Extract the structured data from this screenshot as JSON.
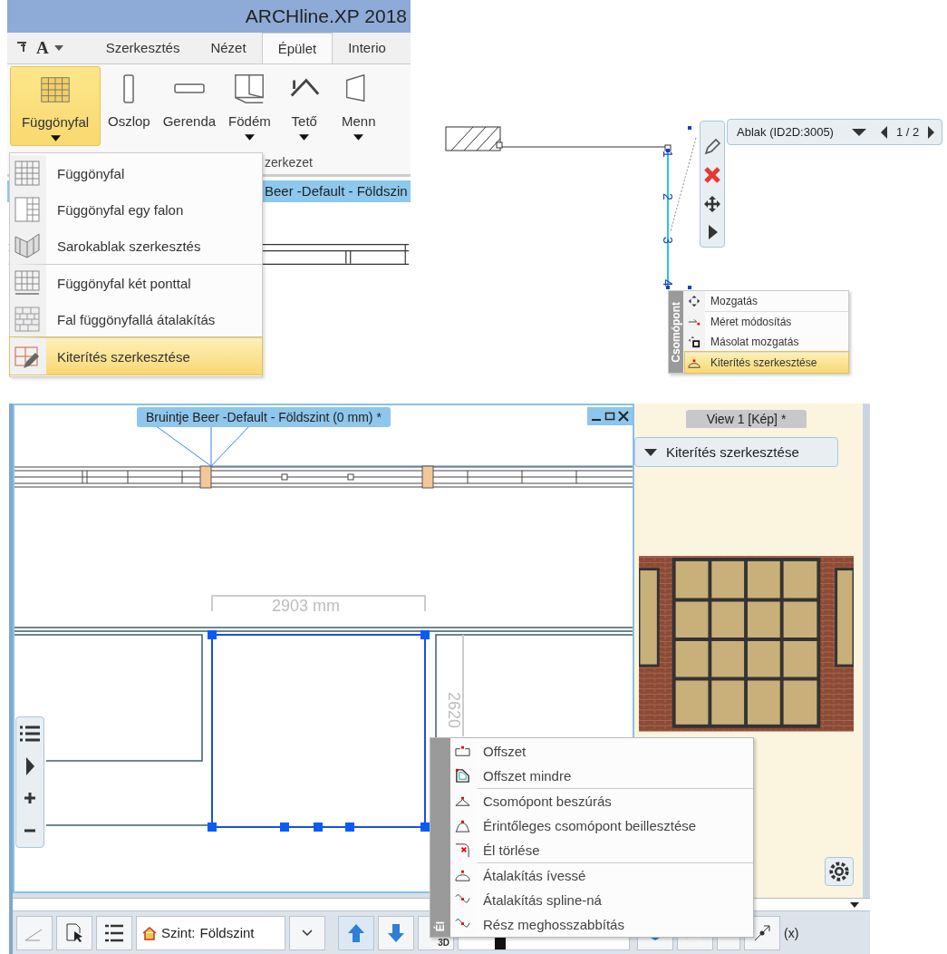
{
  "ribbon_window": {
    "title": "ARCHline.XP 2018",
    "quick_access_glyph": "A",
    "tabs": [
      {
        "label": "Szerkesztés",
        "selected": false
      },
      {
        "label": "Nézet",
        "selected": false
      },
      {
        "label": "Épület",
        "selected": true
      },
      {
        "label": "Interio",
        "selected": false
      }
    ],
    "ribbon_buttons": [
      {
        "label": "Függönyfal",
        "kind": "curtain-wall",
        "has_dropdown": true,
        "selected": true
      },
      {
        "label": "Oszlop",
        "kind": "column",
        "has_dropdown": false,
        "selected": false
      },
      {
        "label": "Gerenda",
        "kind": "beam",
        "has_dropdown": false,
        "selected": false
      },
      {
        "label": "Födém",
        "kind": "slab",
        "has_dropdown": true,
        "selected": false
      },
      {
        "label": "Tető",
        "kind": "roof",
        "has_dropdown": true,
        "selected": false
      },
      {
        "label": "Menn",
        "kind": "stair",
        "has_dropdown": true,
        "selected": false
      }
    ],
    "group_label": "zerkezet",
    "document_tab": "Beer -Default - Földszin",
    "dropdown_menu": [
      {
        "label": "Függönyfal",
        "kind": "grid",
        "separator_before": false,
        "selected": false
      },
      {
        "label": "Függönyfal egy falon",
        "kind": "grid-side",
        "separator_before": false,
        "selected": false
      },
      {
        "label": "Sarokablak szerkesztés",
        "kind": "corner-window",
        "separator_before": false,
        "selected": false
      },
      {
        "label": "Függönyfal két ponttal",
        "kind": "grid-dimension",
        "separator_before": true,
        "selected": false
      },
      {
        "label": "Fal függönyfallá átalakítás",
        "kind": "brick",
        "separator_before": false,
        "selected": false
      },
      {
        "label": "Kiterítés szerkesztése",
        "kind": "unfold-pencil",
        "separator_before": true,
        "selected": true
      }
    ]
  },
  "node_panel": {
    "object_label": "Ablak (ID2D:3005)",
    "page": "1 / 2",
    "node_numbers": [
      "1",
      "2",
      "3",
      "4"
    ],
    "context_menu": {
      "side_label": "Csomópont",
      "items": [
        {
          "label": "Mozgatás",
          "kind": "move",
          "separator_before": false,
          "selected": false
        },
        {
          "label": "Méret módosítás",
          "kind": "resize",
          "separator_before": true,
          "selected": false
        },
        {
          "label": "Másolat mozgatás",
          "kind": "copy-move",
          "separator_before": false,
          "selected": false
        },
        {
          "label": "Kiterítés szerkesztése",
          "kind": "arc-node",
          "separator_before": true,
          "selected": true
        }
      ]
    }
  },
  "main_window": {
    "plan_tab": "Bruintje Beer -Default - Földszint (0 mm) *",
    "view_tab": "View 1 [Kép] *",
    "view_panel_title": "Kiterítés szerkesztése",
    "dimension_horizontal": "2903 mm",
    "dimension_vertical": "2620",
    "edge_menu": {
      "side_label": "Él",
      "items": [
        {
          "label": "Offszet",
          "kind": "offset",
          "separator_before": false
        },
        {
          "label": "Offszet mindre",
          "kind": "offset-all",
          "separator_before": false
        },
        {
          "label": "Csomópont beszúrás",
          "kind": "node-insert",
          "separator_before": true
        },
        {
          "label": "Érintőleges csomópont beillesztése",
          "kind": "tangent-node",
          "separator_before": false
        },
        {
          "label": "Él törlése",
          "kind": "edge-delete",
          "separator_before": false
        },
        {
          "label": "Átalakítás ívessé",
          "kind": "arc",
          "separator_before": true
        },
        {
          "label": "Átalakítás spline-ná",
          "kind": "spline",
          "separator_before": false
        },
        {
          "label": "Rész meghosszabbítás",
          "kind": "spline",
          "separator_before": false
        }
      ]
    },
    "toolbar": {
      "level_label": "Szint:",
      "level_value": "Földszint",
      "view_3d_label": "3D",
      "coords_label": "(x)"
    }
  }
}
